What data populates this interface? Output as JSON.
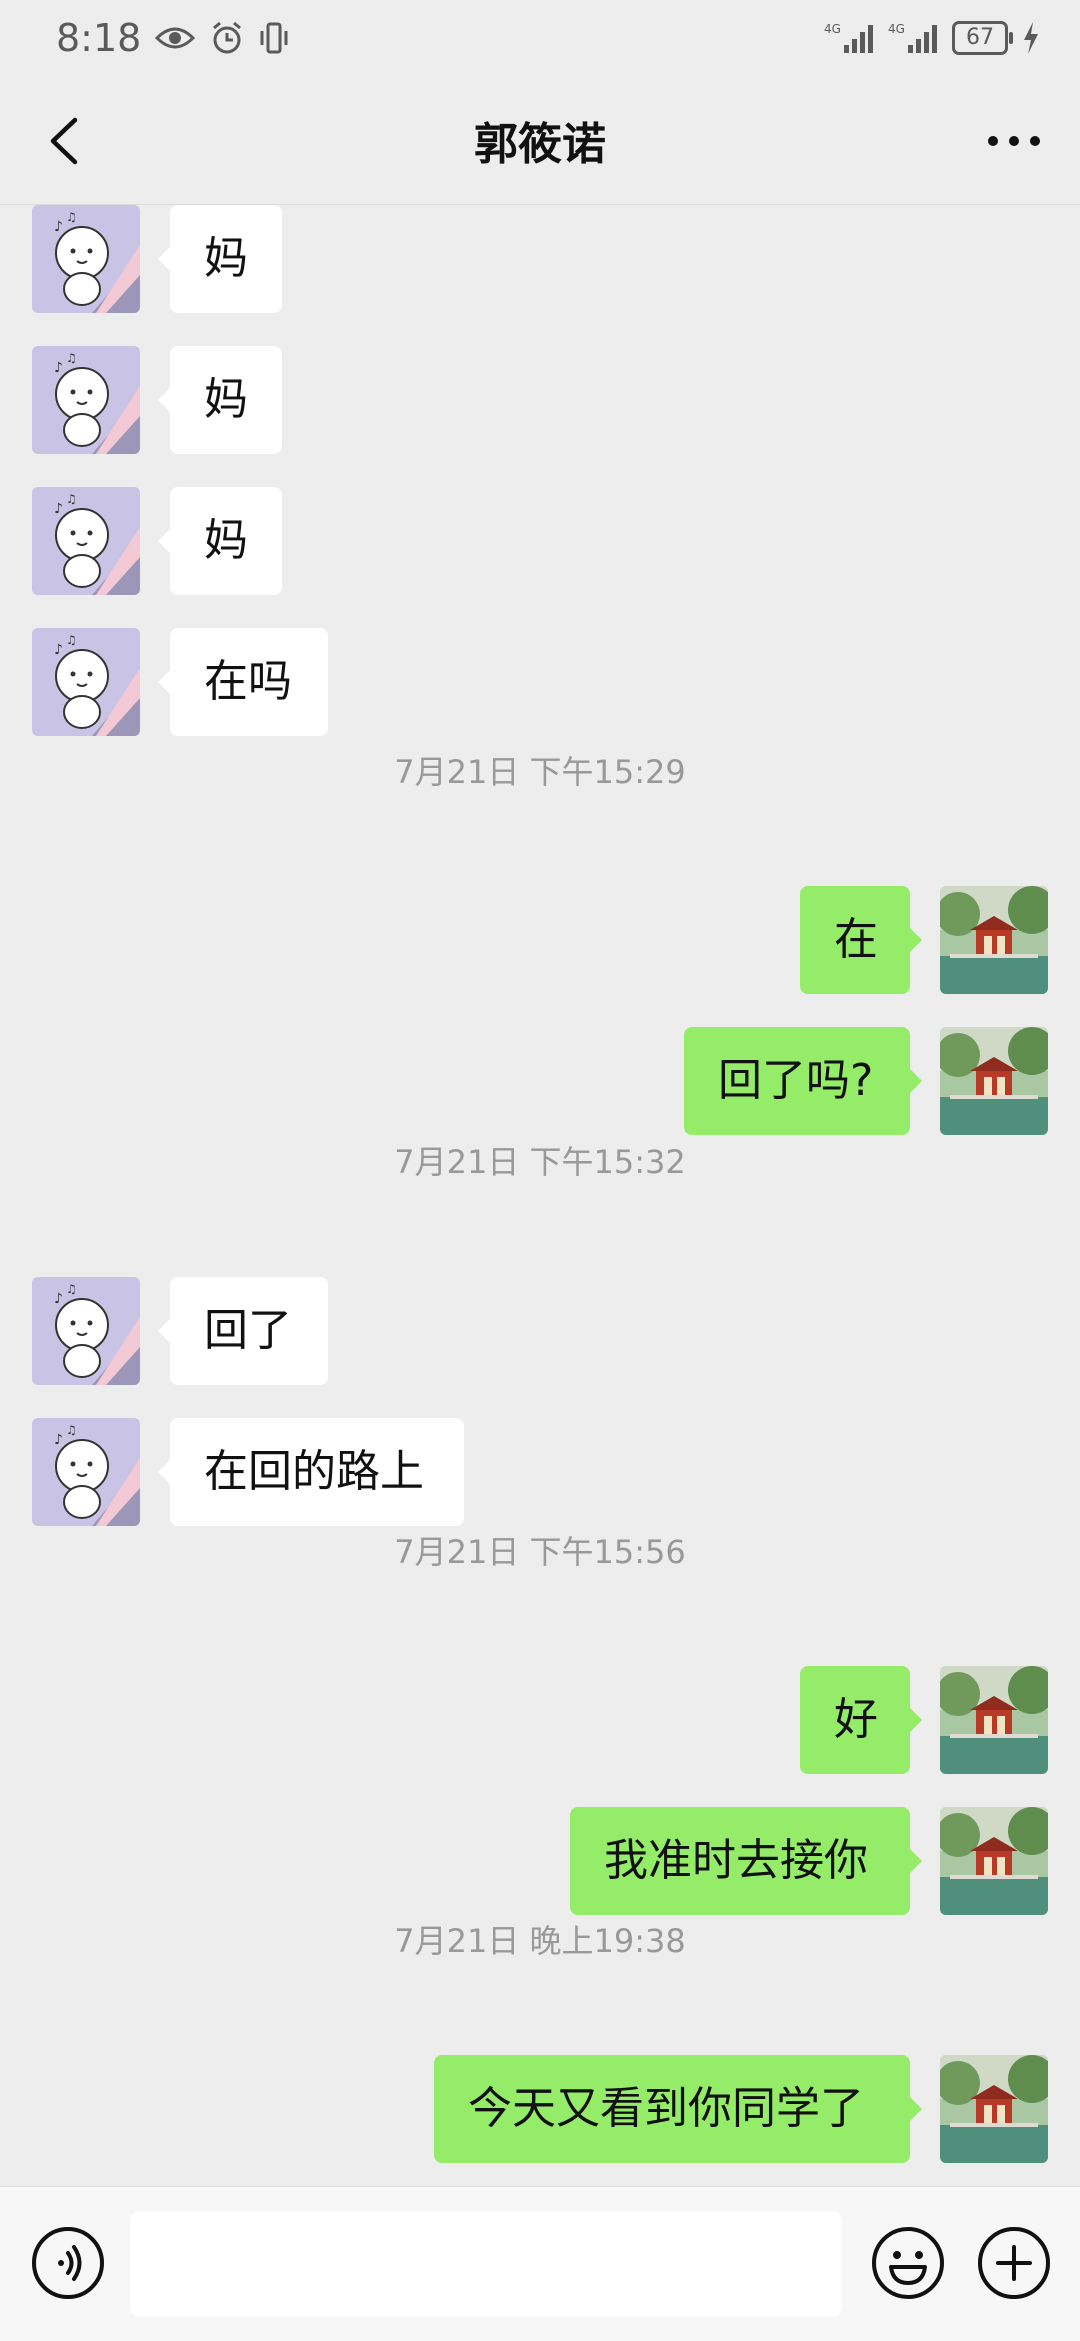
{
  "status_bar": {
    "time": "8:18",
    "battery": "67",
    "network_1": "4G",
    "network_2": "4G"
  },
  "header": {
    "title": "郭筱诺"
  },
  "messages": [
    {
      "type": "in",
      "text": "妈"
    },
    {
      "type": "in",
      "text": "妈"
    },
    {
      "type": "in",
      "text": "妈"
    },
    {
      "type": "in",
      "text": "在吗"
    },
    {
      "type": "time",
      "text": "7月21日 下午15:29"
    },
    {
      "type": "out",
      "text": "在"
    },
    {
      "type": "out",
      "text": "回了吗?"
    },
    {
      "type": "time",
      "text": "7月21日 下午15:32"
    },
    {
      "type": "in",
      "text": "回了"
    },
    {
      "type": "in",
      "text": "在回的路上"
    },
    {
      "type": "time",
      "text": "7月21日 下午15:56"
    },
    {
      "type": "out",
      "text": "好"
    },
    {
      "type": "out",
      "text": "我准时去接你"
    },
    {
      "type": "time",
      "text": "7月21日 晚上19:38"
    },
    {
      "type": "out",
      "text": "今天又看到你同学了"
    }
  ],
  "input_bar": {
    "placeholder": "",
    "value": ""
  },
  "icons": {
    "back": "chevron-left-icon",
    "more": "more-dots-icon",
    "voice": "voice-icon",
    "emoji": "emoji-icon",
    "plus": "plus-icon"
  },
  "colors": {
    "background": "#ededed",
    "outgoing_bubble": "#95ec69",
    "incoming_bubble": "#ffffff",
    "timestamp": "#999999"
  }
}
